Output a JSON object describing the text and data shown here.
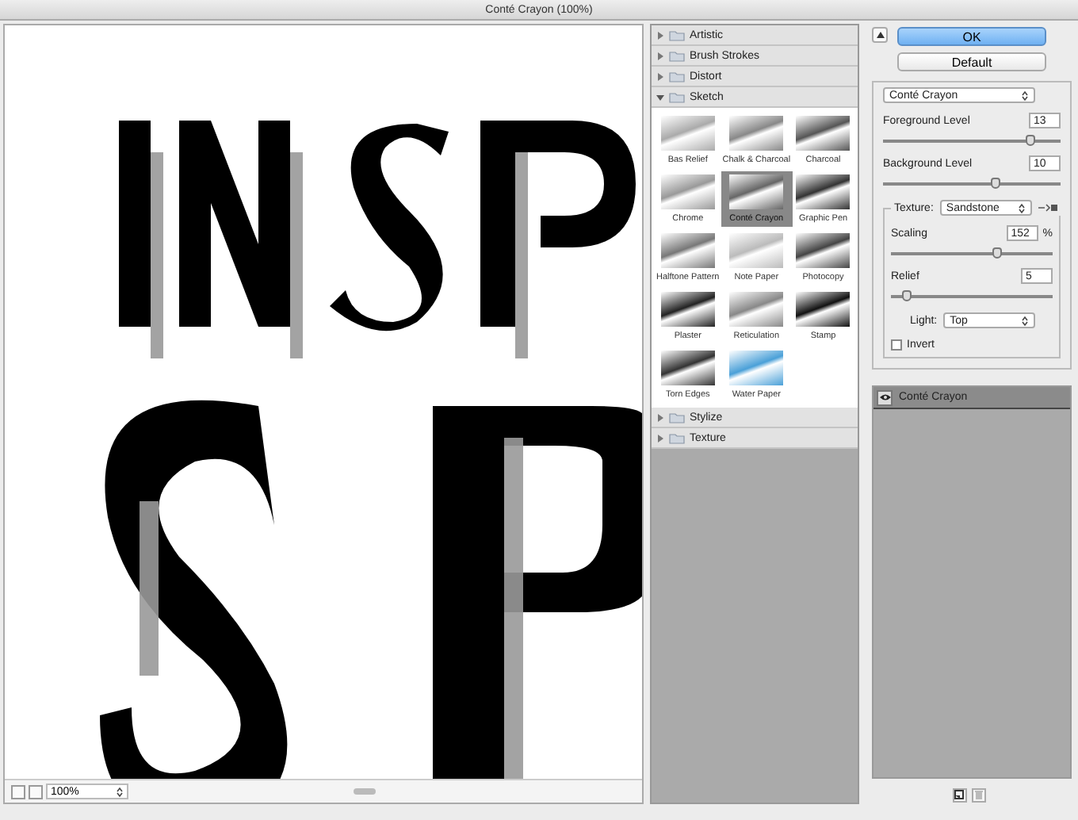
{
  "window": {
    "title": "Conté Crayon (100%)"
  },
  "preview": {
    "zoom": "100%"
  },
  "filter_groups": [
    {
      "name": "Artistic",
      "expanded": false
    },
    {
      "name": "Brush Strokes",
      "expanded": false
    },
    {
      "name": "Distort",
      "expanded": false
    },
    {
      "name": "Sketch",
      "expanded": true,
      "children": [
        {
          "label": "Bas Relief",
          "selected": false
        },
        {
          "label": "Chalk & Charcoal",
          "selected": false
        },
        {
          "label": "Charcoal",
          "selected": false
        },
        {
          "label": "Chrome",
          "selected": false
        },
        {
          "label": "Conté Crayon",
          "selected": true
        },
        {
          "label": "Graphic Pen",
          "selected": false
        },
        {
          "label": "Halftone Pattern",
          "selected": false
        },
        {
          "label": "Note Paper",
          "selected": false
        },
        {
          "label": "Photocopy",
          "selected": false
        },
        {
          "label": "Plaster",
          "selected": false
        },
        {
          "label": "Reticulation",
          "selected": false
        },
        {
          "label": "Stamp",
          "selected": false
        },
        {
          "label": "Torn Edges",
          "selected": false
        },
        {
          "label": "Water Paper",
          "selected": false
        }
      ]
    },
    {
      "name": "Stylize",
      "expanded": false
    },
    {
      "name": "Texture",
      "expanded": false
    }
  ],
  "buttons": [
    {
      "label": "OK",
      "kind": "default"
    },
    {
      "label": "Default",
      "kind": "normal"
    }
  ],
  "settings": {
    "filter": "Conté Crayon",
    "sliders": [
      {
        "label": "Foreground Level",
        "value": "13",
        "level": 0.83
      },
      {
        "label": "Background Level",
        "value": "10",
        "level": 0.63
      }
    ],
    "texture": {
      "label": "Texture:",
      "value": "Sandstone",
      "sliders": [
        {
          "label": "Scaling",
          "value": "152",
          "unit": "%",
          "level": 0.66
        },
        {
          "label": "Relief",
          "value": "5",
          "level": 0.1
        }
      ],
      "light": {
        "label": "Light:",
        "value": "Top"
      },
      "invert": {
        "label": "Invert",
        "checked": false
      }
    }
  },
  "layers": [
    {
      "name": "Conté Crayon",
      "visible": true
    }
  ]
}
